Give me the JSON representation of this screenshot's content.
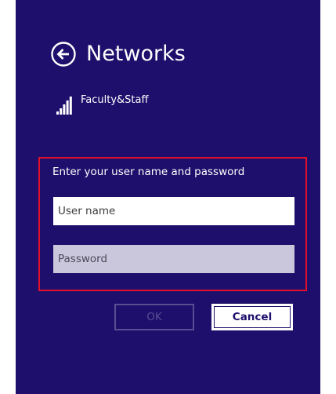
{
  "header": {
    "title": "Networks",
    "back_icon": "arrow-left-circle-icon"
  },
  "network": {
    "name": "Faculty&Staff",
    "signal_icon": "wifi-signal-icon"
  },
  "login": {
    "prompt": "Enter your user name and password",
    "username_placeholder": "User name",
    "password_placeholder": "Password"
  },
  "buttons": {
    "ok_label": "OK",
    "cancel_label": "Cancel"
  },
  "colors": {
    "background": "#1d0f6b",
    "highlight_border": "#e0102a",
    "disabled": "#5a4d92"
  }
}
